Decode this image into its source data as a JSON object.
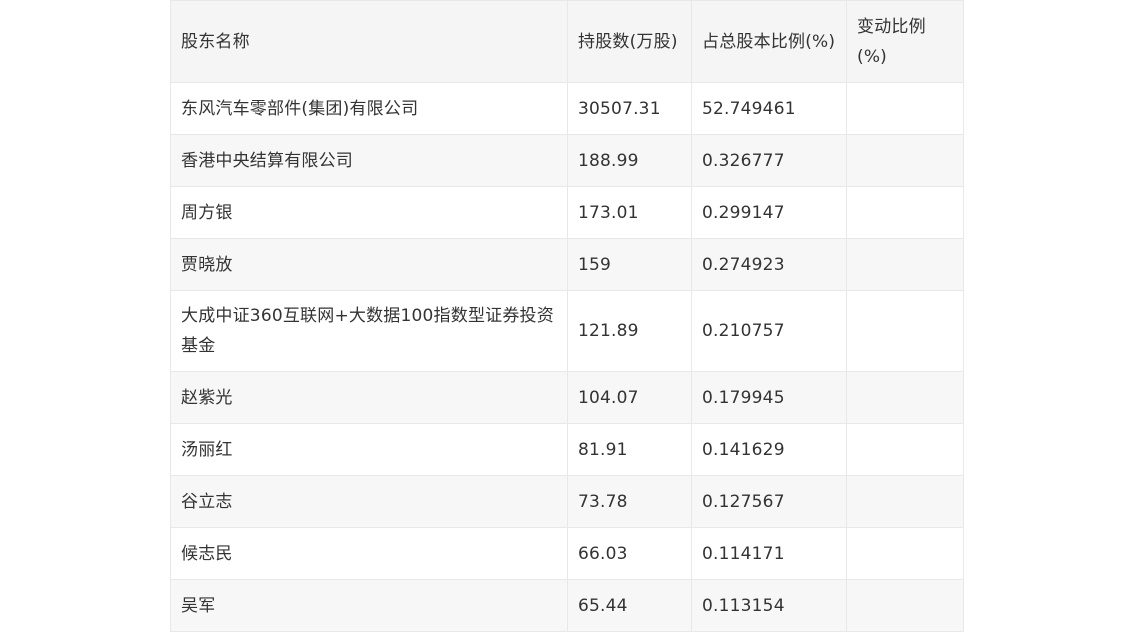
{
  "table": {
    "headers": [
      "股东名称",
      "持股数(万股)",
      "占总股本比例(%)",
      "变动比例(%)"
    ],
    "rows": [
      {
        "name": "东风汽车零部件(集团)有限公司",
        "shares": "30507.31",
        "ratio": "52.749461",
        "change": ""
      },
      {
        "name": "香港中央结算有限公司",
        "shares": "188.99",
        "ratio": "0.326777",
        "change": ""
      },
      {
        "name": "周方银",
        "shares": "173.01",
        "ratio": "0.299147",
        "change": ""
      },
      {
        "name": "贾晓放",
        "shares": "159",
        "ratio": "0.274923",
        "change": ""
      },
      {
        "name": "大成中证360互联网+大数据100指数型证券投资基金",
        "shares": "121.89",
        "ratio": "0.210757",
        "change": ""
      },
      {
        "name": "赵紫光",
        "shares": "104.07",
        "ratio": "0.179945",
        "change": ""
      },
      {
        "name": "汤丽红",
        "shares": "81.91",
        "ratio": "0.141629",
        "change": ""
      },
      {
        "name": "谷立志",
        "shares": "73.78",
        "ratio": "0.127567",
        "change": ""
      },
      {
        "name": "候志民",
        "shares": "66.03",
        "ratio": "0.114171",
        "change": ""
      },
      {
        "name": "吴军",
        "shares": "65.44",
        "ratio": "0.113154",
        "change": ""
      }
    ]
  }
}
